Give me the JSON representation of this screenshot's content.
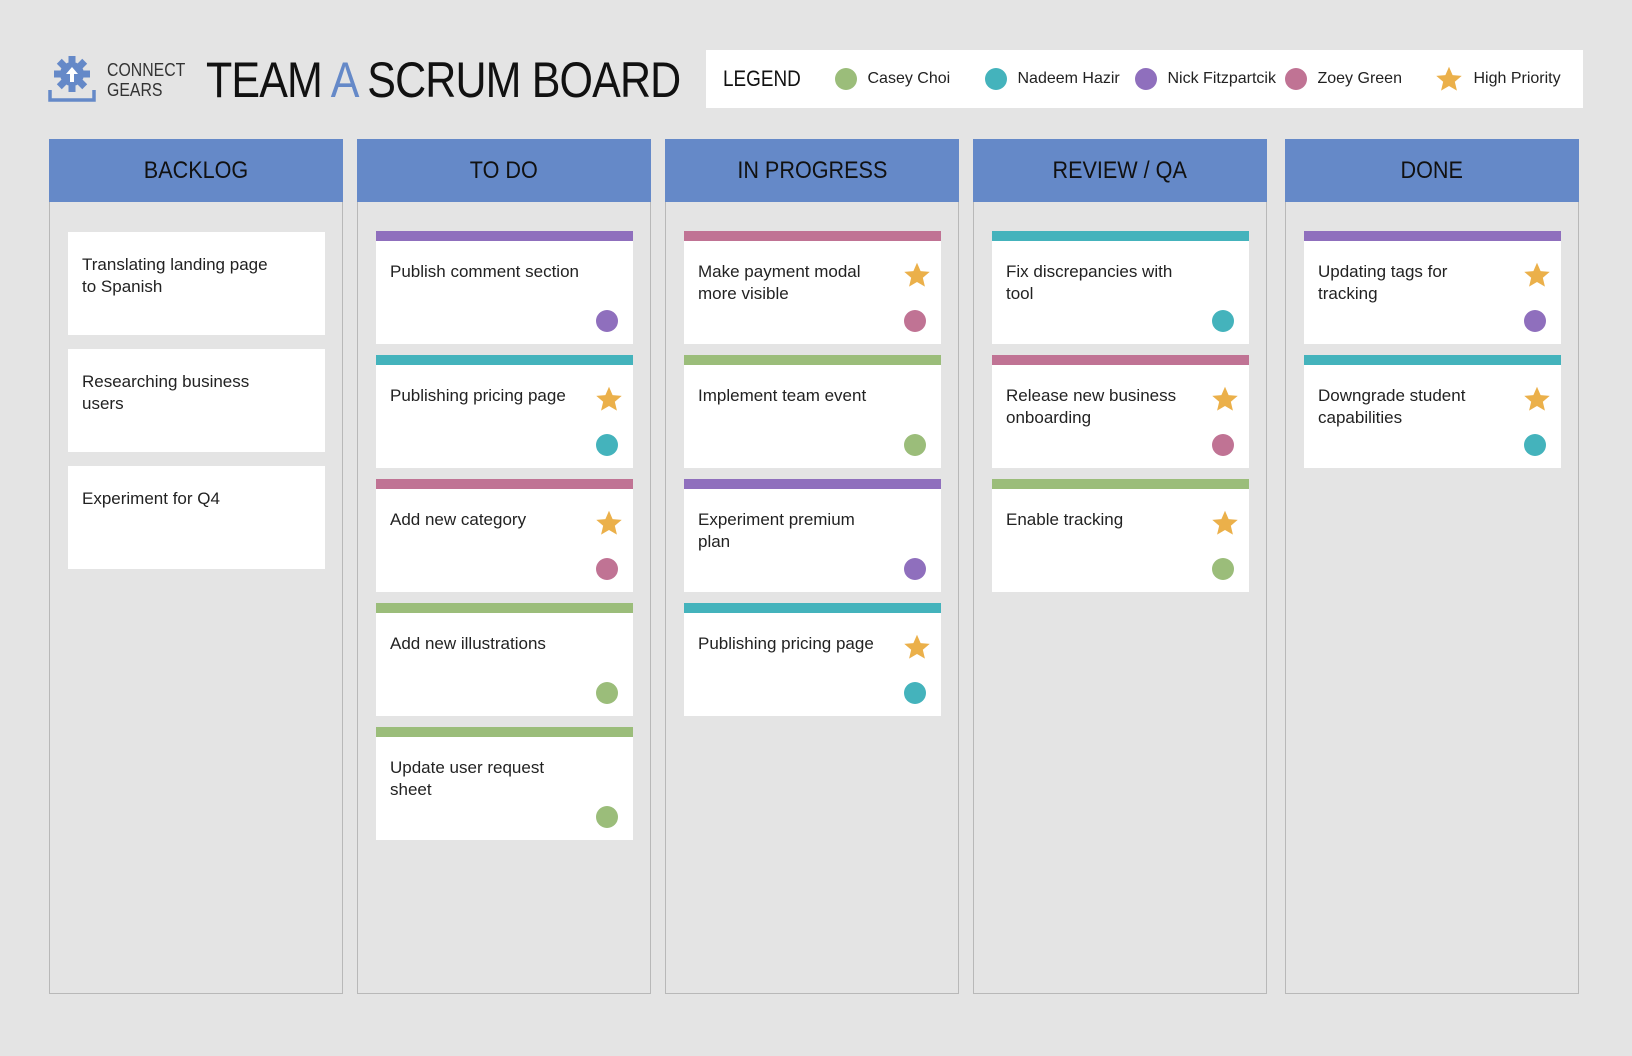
{
  "brand": {
    "line1": "CONNECT",
    "line2": "GEARS",
    "logo_icon": "gear-upload-icon"
  },
  "title": {
    "part1": "TEAM ",
    "accent": "A",
    "part2": " SCRUM BOARD"
  },
  "colors": {
    "accent": "#6589c8",
    "casey": "#9bbd7a",
    "nadeem": "#44b3bc",
    "nick": "#8f6fbd",
    "zoey": "#c07394",
    "star": "#ebb04a"
  },
  "legend": {
    "label": "LEGEND",
    "items": [
      {
        "name": "Casey Choi",
        "color": "#9bbd7a",
        "icon": "circle"
      },
      {
        "name": "Nadeem Hazir",
        "color": "#44b3bc",
        "icon": "circle"
      },
      {
        "name": "Nick Fitzpartcik",
        "color": "#8f6fbd",
        "icon": "circle"
      },
      {
        "name": "Zoey Green",
        "color": "#c07394",
        "icon": "circle"
      },
      {
        "name": "High Priority",
        "color": "#ebb04a",
        "icon": "star"
      }
    ]
  },
  "columns": [
    {
      "title": "BACKLOG",
      "cards": [
        {
          "text": "Translating landing page to Spanish",
          "color": null,
          "priority": false
        },
        {
          "text": "Researching business users",
          "color": null,
          "priority": false
        },
        {
          "text": "Experiment for Q4",
          "color": null,
          "priority": false
        }
      ]
    },
    {
      "title": "TO DO",
      "cards": [
        {
          "text": "Publish comment section",
          "color": "#8f6fbd",
          "priority": false
        },
        {
          "text": "Publishing pricing page",
          "color": "#44b3bc",
          "priority": true
        },
        {
          "text": "Add new category",
          "color": "#c07394",
          "priority": true
        },
        {
          "text": "Add new illustrations",
          "color": "#9bbd7a",
          "priority": false
        },
        {
          "text": "Update user request sheet",
          "color": "#9bbd7a",
          "priority": false
        }
      ]
    },
    {
      "title": "IN PROGRESS",
      "cards": [
        {
          "text": "Make payment modal more visible",
          "color": "#c07394",
          "priority": true
        },
        {
          "text": "Implement team event",
          "color": "#9bbd7a",
          "priority": false
        },
        {
          "text": "Experiment premium plan",
          "color": "#8f6fbd",
          "priority": false
        },
        {
          "text": "Publishing pricing page",
          "color": "#44b3bc",
          "priority": true
        }
      ]
    },
    {
      "title": "REVIEW / QA",
      "cards": [
        {
          "text": "Fix discrepancies with tool",
          "color": "#44b3bc",
          "priority": false
        },
        {
          "text": "Release new business onboarding",
          "color": "#c07394",
          "priority": true
        },
        {
          "text": "Enable tracking",
          "color": "#9bbd7a",
          "priority": true
        }
      ]
    },
    {
      "title": "DONE",
      "cards": [
        {
          "text": "Updating tags for tracking",
          "color": "#8f6fbd",
          "priority": true
        },
        {
          "text": "Downgrade student capabilities",
          "color": "#44b3bc",
          "priority": true
        }
      ]
    }
  ]
}
